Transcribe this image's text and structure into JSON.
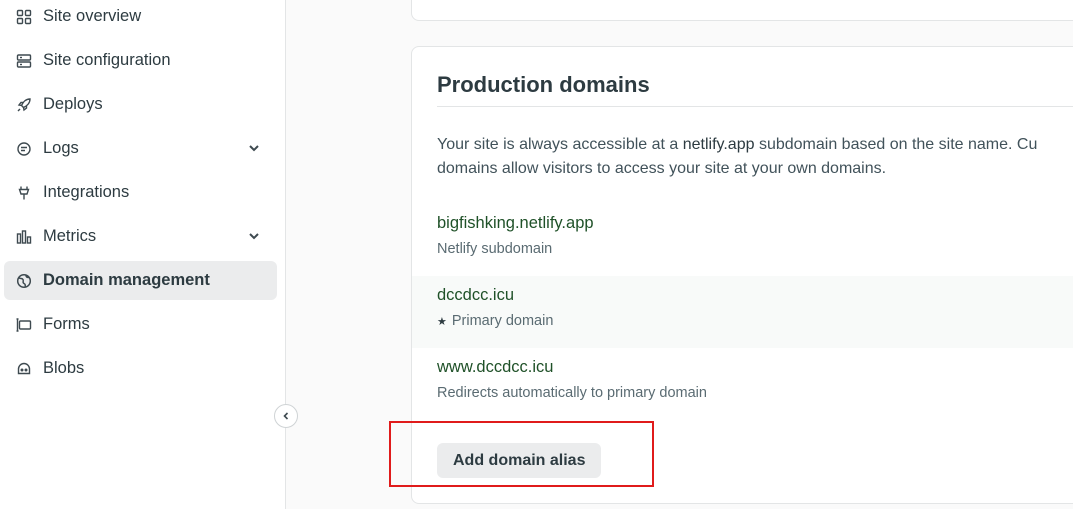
{
  "sidebar": {
    "items": [
      {
        "label": "Site overview",
        "icon": "grid-icon"
      },
      {
        "label": "Site configuration",
        "icon": "server-icon"
      },
      {
        "label": "Deploys",
        "icon": "rocket-icon"
      },
      {
        "label": "Logs",
        "icon": "logs-icon",
        "expandable": true
      },
      {
        "label": "Integrations",
        "icon": "plug-icon"
      },
      {
        "label": "Metrics",
        "icon": "bar-chart-icon",
        "expandable": true
      },
      {
        "label": "Domain management",
        "icon": "globe-icon",
        "active": true
      },
      {
        "label": "Forms",
        "icon": "form-icon"
      },
      {
        "label": "Blobs",
        "icon": "blob-icon"
      }
    ]
  },
  "card": {
    "title": "Production domains",
    "desc_line1_pre": "Your site is always accessible at a ",
    "desc_line1_mono": "netlify.app",
    "desc_line1_post": " subdomain based on the site name. Cu",
    "desc_line2": "domains allow visitors to access your site at your own domains.",
    "domains": [
      {
        "name": "bigfishking.netlify.app",
        "sub": "Netlify subdomain"
      },
      {
        "name": "dccdcc.icu",
        "sub": "Primary domain",
        "primary": true
      },
      {
        "name": "www.dccdcc.icu",
        "sub": "Redirects automatically to primary domain"
      }
    ],
    "add_button": "Add domain alias"
  },
  "colors": {
    "accent_text": "#1f5128",
    "highlight": "#e01b1b",
    "active_bg": "#ebeced"
  }
}
